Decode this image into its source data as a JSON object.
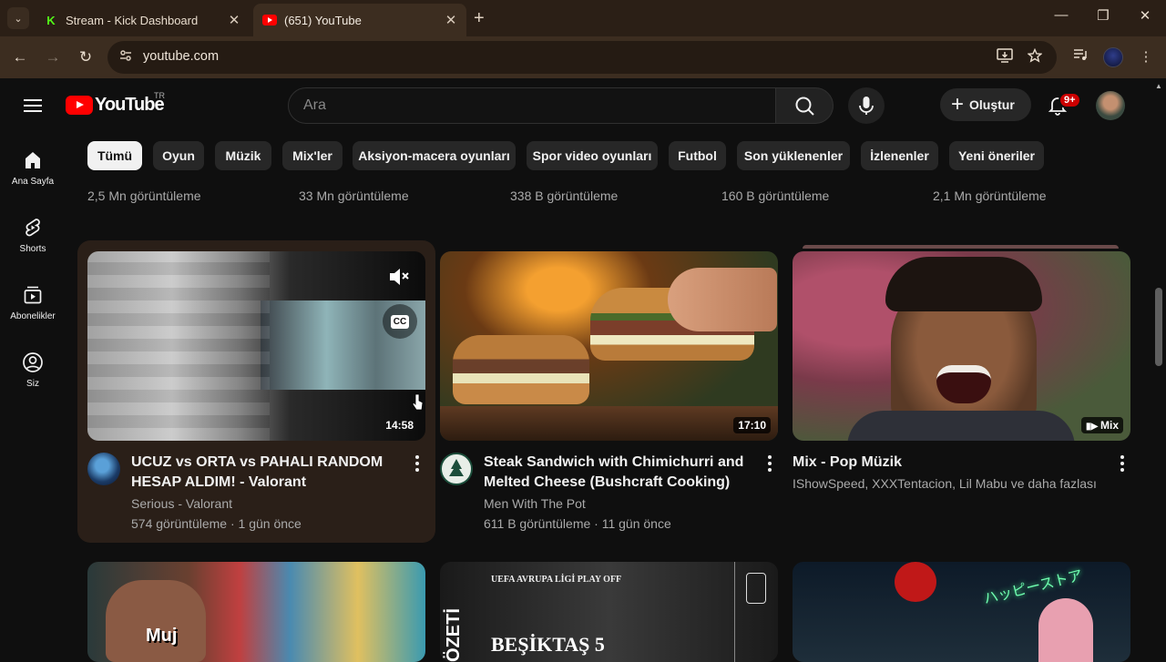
{
  "browser": {
    "tabs": [
      {
        "title": "Stream - Kick Dashboard",
        "favicon": "K"
      },
      {
        "title": "(651) YouTube",
        "favicon": "youtube-icon"
      }
    ],
    "url": "youtube.com",
    "icons": {
      "back": "←",
      "forward": "→",
      "reload": "↻",
      "minimize": "—",
      "restore": "❐",
      "close": "✕",
      "new_tab": "+",
      "tab_close": "✕",
      "tab_list": "⌄"
    }
  },
  "header": {
    "logo_text": "YouTube",
    "country_code": "TR",
    "search_placeholder": "Ara",
    "create_label": "Oluştur",
    "notification_count": "9+"
  },
  "sidebar": [
    {
      "label": "Ana Sayfa",
      "icon": "home-icon"
    },
    {
      "label": "Shorts",
      "icon": "shorts-icon"
    },
    {
      "label": "Abonelikler",
      "icon": "subscriptions-icon"
    },
    {
      "label": "Siz",
      "icon": "you-icon"
    }
  ],
  "chips": [
    "Tümü",
    "Oyun",
    "Müzik",
    "Mix'ler",
    "Aksiyon-macera oyunları",
    "Spor video oyunları",
    "Futbol",
    "Son yüklenenler",
    "İzlenenler",
    "Yeni öneriler"
  ],
  "previous_row_views": [
    "2,5 Mn görüntüleme",
    "33 Mn görüntüleme",
    "338 B görüntüleme",
    "160 B görüntüleme",
    "2,1 Mn görüntüleme"
  ],
  "videos": [
    {
      "title_line1": "UCUZ vs ORTA vs PAHALI RANDOM",
      "title_line2": "HESAP ALDIM! - Valorant",
      "channel": "Serious - Valorant",
      "meta": "574 görüntüleme · 1 gün önce",
      "duration": "14:58",
      "cc_label": "CC"
    },
    {
      "title_line1": "Steak Sandwich with Chimichurri and",
      "title_line2": "Melted Cheese (Bushcraft Cooking)",
      "channel": "Men With The Pot",
      "meta": "611 B görüntüleme · 11 gün önce",
      "duration": "17:10"
    },
    {
      "title_line1": "Mix - Pop Müzik",
      "channel": "IShowSpeed, XXXTentacion, Lil Mabu ve daha fazlası",
      "duration": "Mix"
    }
  ],
  "next_row": [
    {
      "overlay_text": "Muj"
    },
    {
      "overlay_text_top": "UEFA AVRUPA LİGİ PLAY OFF",
      "overlay_text_vertical": "ÖZETİ",
      "overlay_text_main": "BEŞİKTAŞ 5"
    },
    {
      "overlay_text": "ハッピーストア"
    }
  ]
}
